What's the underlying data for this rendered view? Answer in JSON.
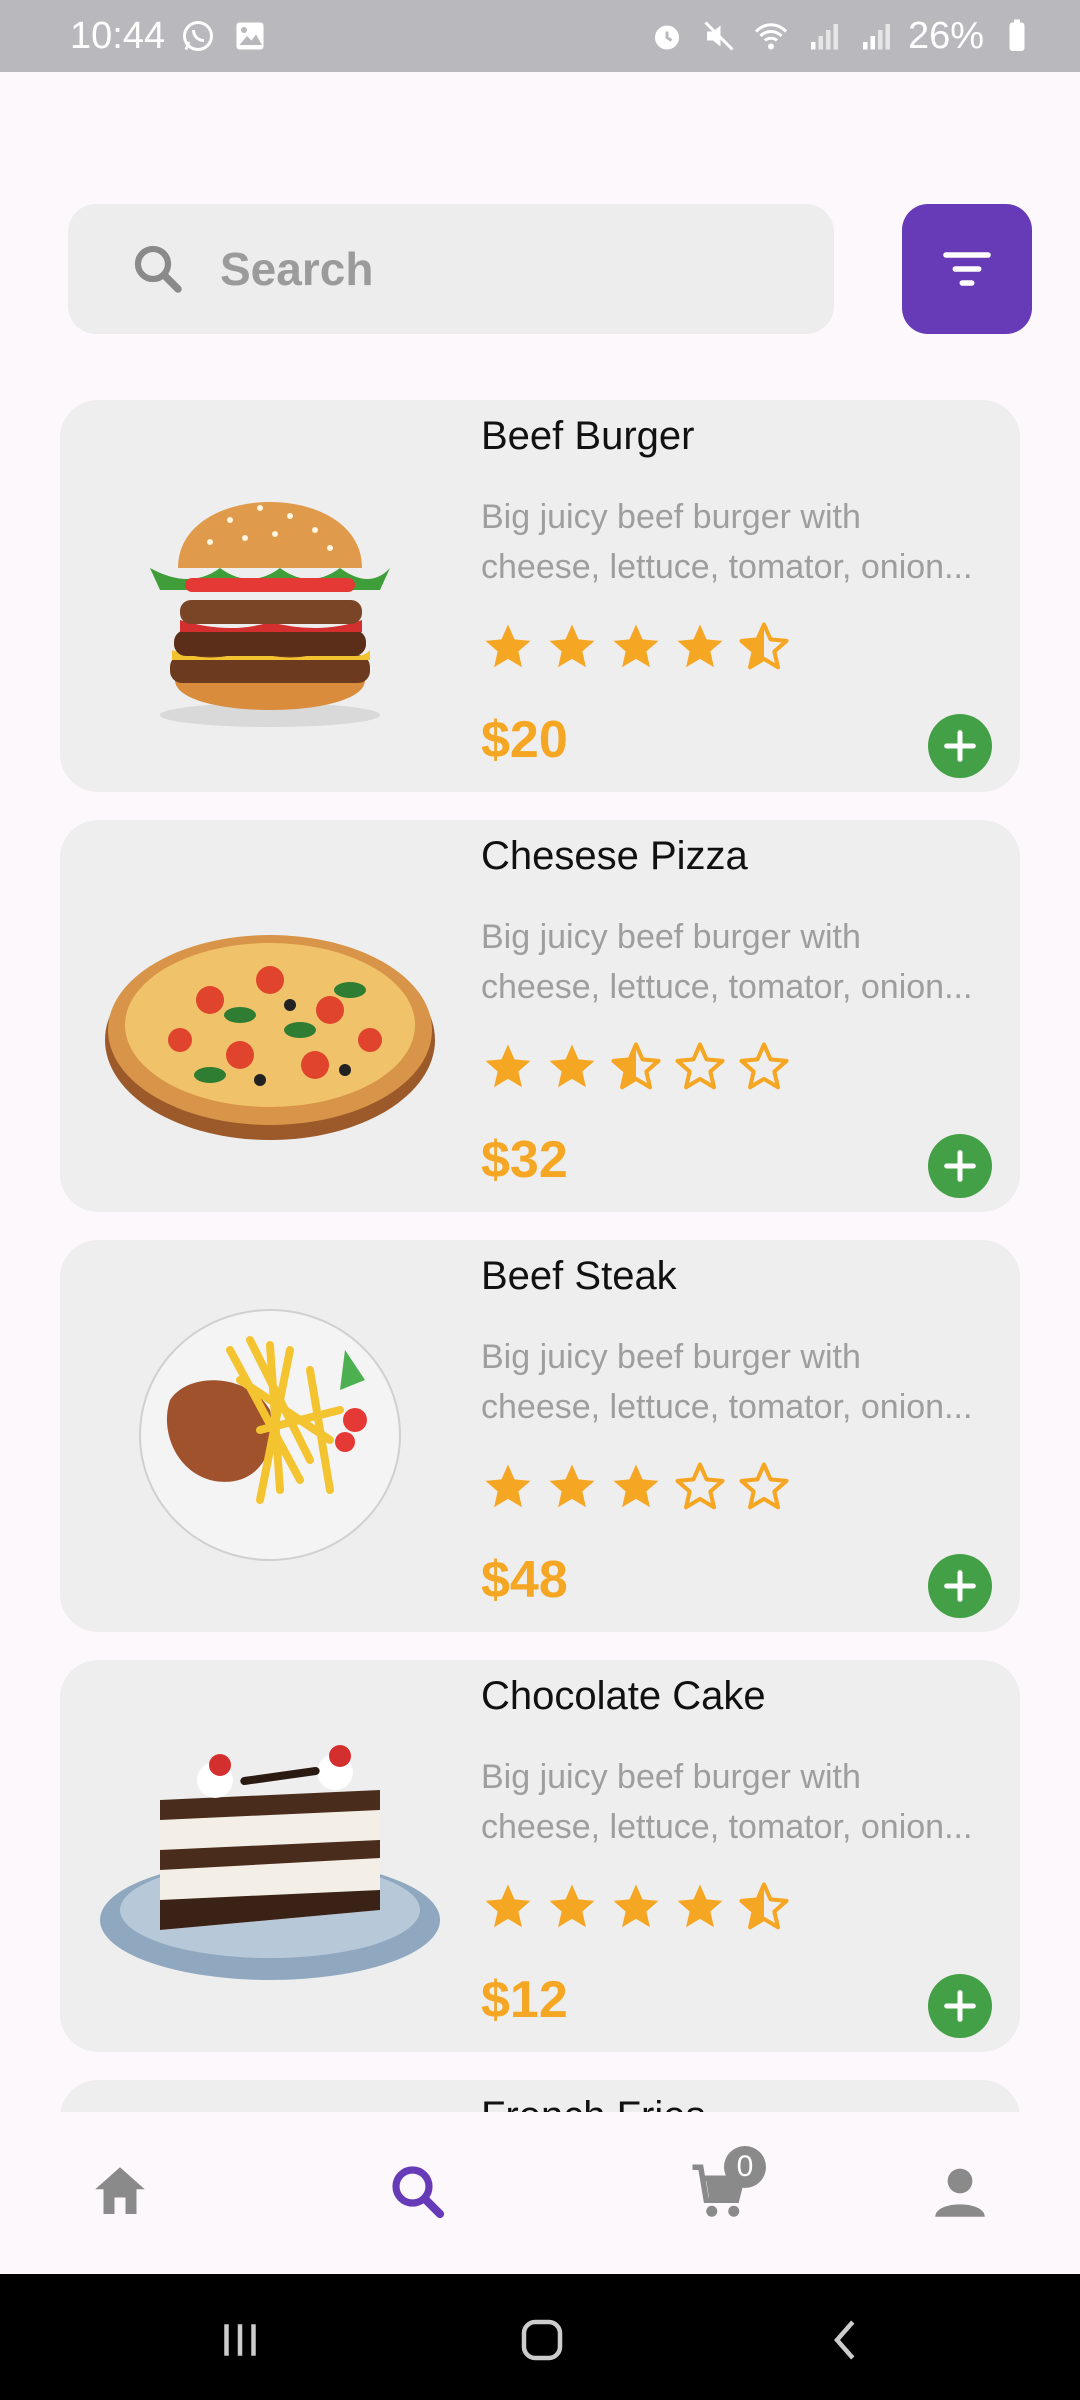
{
  "status_bar": {
    "time": "10:44",
    "battery": "26%",
    "icons": [
      "whatsapp-icon",
      "gallery-icon",
      "alarm-icon",
      "mute-icon",
      "wifi-icon",
      "signal-icon",
      "signal-icon",
      "battery-icon"
    ]
  },
  "search": {
    "placeholder": "Search",
    "icon": "search-icon"
  },
  "filter": {
    "icon": "filter-icon",
    "color": "#673ab7"
  },
  "foods": [
    {
      "name": "Beef Burger",
      "desc_line1": "Big juicy beef burger with",
      "desc_line2": "cheese, lettuce, tomator, onion...",
      "rating": 4.5,
      "price": "$20",
      "image": "burger-image"
    },
    {
      "name": "Chesese Pizza",
      "desc_line1": "Big juicy beef burger with",
      "desc_line2": "cheese, lettuce, tomator, onion...",
      "rating": 2.5,
      "price": "$32",
      "image": "pizza-image"
    },
    {
      "name": "Beef Steak",
      "desc_line1": "Big juicy beef burger with",
      "desc_line2": "cheese, lettuce, tomator, onion...",
      "rating": 3,
      "price": "$48",
      "image": "steak-image"
    },
    {
      "name": "Chocolate Cake",
      "desc_line1": "Big juicy beef burger with",
      "desc_line2": "cheese, lettuce, tomator, onion...",
      "rating": 4.5,
      "price": "$12",
      "image": "cake-image"
    },
    {
      "name": "French Fries",
      "desc_line1": "",
      "desc_line2": "",
      "rating": 0,
      "price": "",
      "image": ""
    }
  ],
  "colors": {
    "star": "#f5a623",
    "price": "#f5a623",
    "add_button": "#43a047",
    "nav_active": "#673ab7",
    "nav_inactive": "#8a8a8a"
  },
  "bottom_nav": {
    "items": [
      "home-icon",
      "search-icon",
      "cart-icon",
      "person-icon"
    ],
    "active": "search",
    "cart_count": "0"
  },
  "system_nav": [
    "recents-icon",
    "home-icon",
    "back-icon"
  ]
}
